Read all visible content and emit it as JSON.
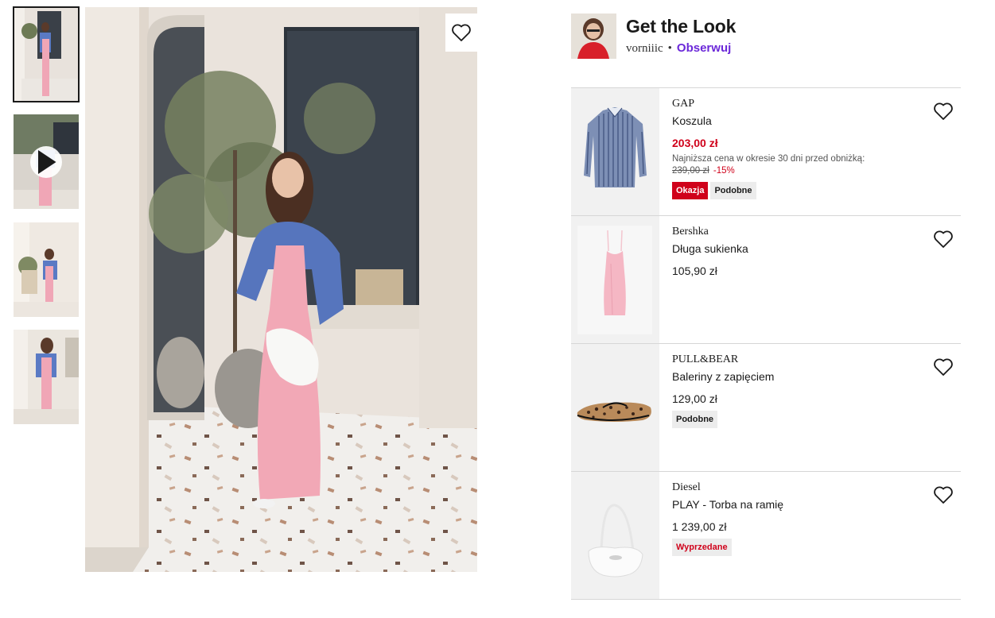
{
  "gallery": {
    "thumbnails": [
      {
        "kind": "photo",
        "active": true
      },
      {
        "kind": "video",
        "active": false
      },
      {
        "kind": "photo",
        "active": false
      },
      {
        "kind": "photo",
        "active": false
      }
    ]
  },
  "look": {
    "title": "Get the Look",
    "username": "vorniiic",
    "separator": "•",
    "follow_label": "Obserwuj"
  },
  "products": [
    {
      "brand": "GAP",
      "name": "Koszula",
      "price": "203,00 zł",
      "price_is_sale": true,
      "lowest_price_note": "Najniższa cena w okresie 30 dni przed obniżką:",
      "old_price": "239,00 zł",
      "discount": "-15%",
      "badges": [
        {
          "label": "Okazja",
          "style": "okazja"
        },
        {
          "label": "Podobne",
          "style": "grey"
        }
      ],
      "image": "striped-shirt"
    },
    {
      "brand": "Bershka",
      "name": "Długa sukienka",
      "price": "105,90 zł",
      "price_is_sale": false,
      "badges": [],
      "image": "pink-dress"
    },
    {
      "brand": "PULL&BEAR",
      "name": "Baleriny z zapięciem",
      "price": "129,00 zł",
      "price_is_sale": false,
      "badges": [
        {
          "label": "Podobne",
          "style": "grey"
        }
      ],
      "image": "leopard-flats"
    },
    {
      "brand": "Diesel",
      "name": "PLAY - Torba na ramię",
      "price": "1 239,00 zł",
      "price_is_sale": false,
      "badges": [
        {
          "label": "Wyprzedane",
          "style": "soldout"
        }
      ],
      "image": "white-shoulder-bag"
    }
  ],
  "icons": {
    "wishlist": "heart-outline-icon",
    "play": "play-icon"
  },
  "colors": {
    "sale_red": "#d0021b",
    "follow_purple": "#6b28d9",
    "badge_grey": "#ececec"
  }
}
